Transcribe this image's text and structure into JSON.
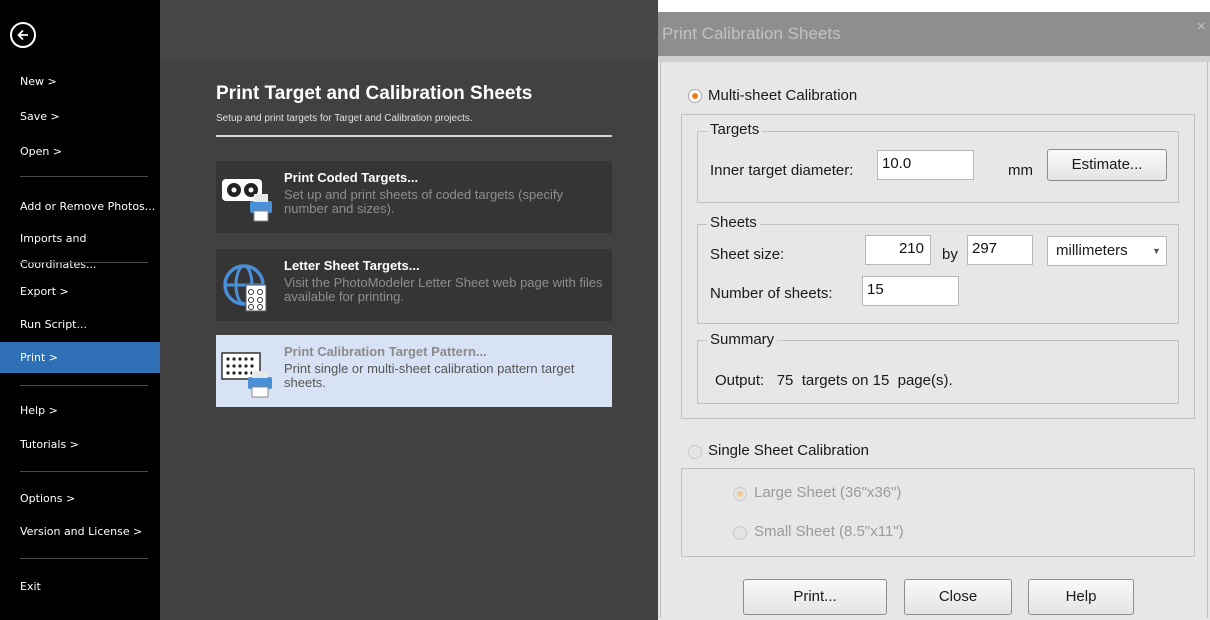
{
  "menu": {
    "back_icon": "back-arrow-icon",
    "items": [
      {
        "label": "New >"
      },
      {
        "label": "Save >"
      },
      {
        "label": "Open >"
      },
      {
        "label": "Add or Remove Photos..."
      },
      {
        "label": "Imports and Coordinates..."
      },
      {
        "label": "Export >"
      },
      {
        "label": "Run Script..."
      },
      {
        "label": "Print >"
      },
      {
        "label": "Help >"
      },
      {
        "label": "Tutorials >"
      },
      {
        "label": "Options >"
      },
      {
        "label": "Version and License >"
      },
      {
        "label": "Exit"
      }
    ],
    "active": "Print >"
  },
  "panel": {
    "title": "Print Target and Calibration Sheets",
    "subtitle": "Setup and print targets for Target and Calibration projects.",
    "options": [
      {
        "title": "Print Coded Targets...",
        "description": "Set up and print sheets of coded targets (specify number and sizes).",
        "icon": "coded-targets-printer-icon"
      },
      {
        "title": "Letter Sheet Targets...",
        "description": "Visit the PhotoModeler Letter Sheet web page with files available for printing.",
        "icon": "globe-target-sheet-icon"
      },
      {
        "title": "Print Calibration Target Pattern...",
        "description": "Print single or multi-sheet calibration pattern target sheets.",
        "icon": "calibration-grid-printer-icon"
      }
    ]
  },
  "dialog": {
    "title": "Print Calibration Sheets",
    "close_label": "×",
    "multi_sheet": {
      "label": "Multi-sheet Calibration",
      "selected": true,
      "targets": {
        "group_label": "Targets",
        "inner_diameter_label": "Inner target diameter:",
        "inner_diameter_value": "10.0",
        "unit": "mm",
        "estimate_label": "Estimate..."
      },
      "sheets": {
        "group_label": "Sheets",
        "size_label": "Sheet size:",
        "width": "210",
        "by_label": "by",
        "height": "297",
        "unit_selected": "millimeters",
        "count_label": "Number of sheets:",
        "count_value": "15"
      },
      "summary": {
        "group_label": "Summary",
        "text": "Output:   75  targets on 15  page(s)."
      }
    },
    "single_sheet": {
      "label": "Single Sheet Calibration",
      "selected": false,
      "large_label": "Large Sheet (36\"x36\")",
      "large_selected": true,
      "small_label": "Small Sheet (8.5\"x11\")"
    },
    "buttons": {
      "print": "Print...",
      "close": "Close",
      "help": "Help"
    }
  },
  "colors": {
    "menu_bg": "#000000",
    "menu_active": "#2f6fb6",
    "panel_bg": "#414141",
    "option_bg": "#353535",
    "option_selected": "#d7e3f4",
    "dialog_bg": "#e7e7e7",
    "dialog_title": "#8e8e8e",
    "radio_accent": "#f07c12"
  }
}
